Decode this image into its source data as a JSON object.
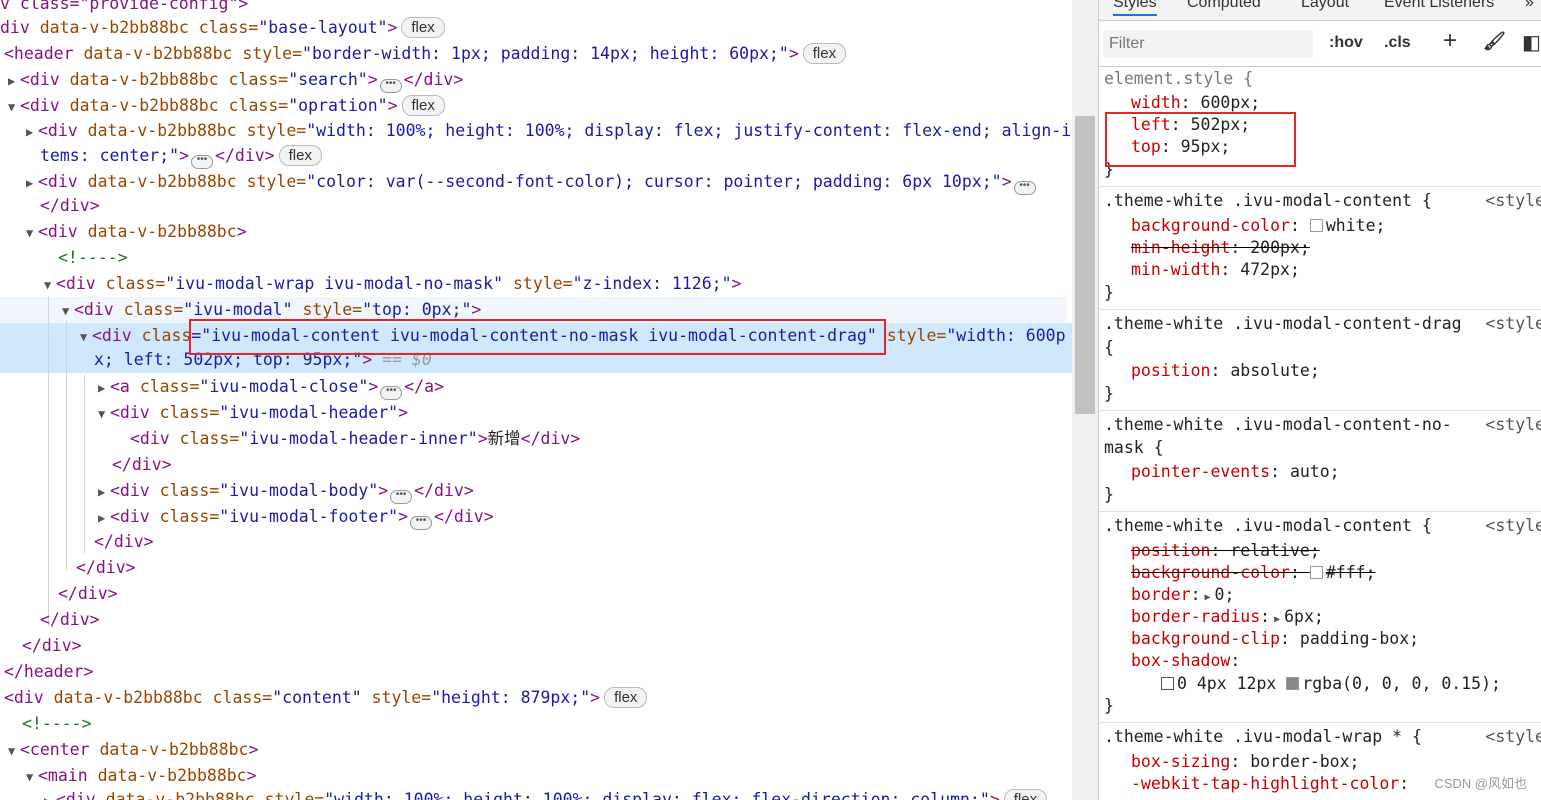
{
  "elements": {
    "l0": "v class=\"provide-config\">",
    "l1_open": "div ",
    "l1_attr": "data-v-b2bb88bc",
    "l1_cls": " class=",
    "l1_val": "\"base-layout\"",
    "l1_close": ">",
    "l1_pill": "flex",
    "l2_open": "<header ",
    "l2_attr": "data-v-b2bb88bc",
    "l2_sty": " style=",
    "l2_val": "\"border-width: 1px; padding: 14px; height: 60px;\"",
    "l2_close": ">",
    "l2_pill": "flex",
    "l3_open": "<div ",
    "l3_attr": "data-v-b2bb88bc",
    "l3_cls": " class=",
    "l3_val": "\"search\"",
    "l3_close": ">",
    "l3_end": "</div>",
    "l4_open": "<div ",
    "l4_attr": "data-v-b2bb88bc",
    "l4_cls": " class=",
    "l4_val": "\"opration\"",
    "l4_close": ">",
    "l4_pill": "flex",
    "l5_open": "<div ",
    "l5_attr": "data-v-b2bb88bc",
    "l5_sty": " style=",
    "l5_val": "\"width: 100%; height: 100%; display: flex; justify-content: flex-end; align-i",
    "l6_val": "tems: center;\"",
    "l6_close": ">",
    "l6_end": "</div>",
    "l6_pill": "flex",
    "l7_open": "<div ",
    "l7_attr": "data-v-b2bb88bc",
    "l7_sty": " style=",
    "l7_val": "\"color: var(--second-font-color); cursor: pointer; padding: 6px 10px;\"",
    "l7_close": ">",
    "l8": "</div>",
    "l9_open": "<div ",
    "l9_attr": "data-v-b2bb88bc",
    "l9_close": ">",
    "l10": "<!---->",
    "l11_open": "<div ",
    "l11_cls": "class=",
    "l11_val": "\"ivu-modal-wrap ivu-modal-no-mask\"",
    "l11_sty": " style=",
    "l11_sval": "\"z-index: 1126;\"",
    "l11_close": ">",
    "l12_open": "<div ",
    "l12_cls": "class=",
    "l12_val": "\"ivu-modal\"",
    "l12_sty": " style=",
    "l12_sval": "\"top: 0px;\"",
    "l12_close": ">",
    "l13_open": "<div ",
    "l13_cls": "class",
    "l13_val": "=\"ivu-modal-content ivu-modal-content-no-mask ivu-modal-content-drag\"",
    "l13_sty": " style=",
    "l13_sval": "\"width: 600p",
    "l14_sval": "x; left: 502px; top: 95px;\"",
    "l14_close": ">",
    "l14_eq": " == $0",
    "l15_open": "<a ",
    "l15_cls": "class=",
    "l15_val": "\"ivu-modal-close\"",
    "l15_close": ">",
    "l15_end": "</a>",
    "l16_open": "<div ",
    "l16_cls": "class=",
    "l16_val": "\"ivu-modal-header\"",
    "l16_close": ">",
    "l17_open": "<div ",
    "l17_cls": "class=",
    "l17_val": "\"ivu-modal-header-inner\"",
    "l17_close": ">",
    "l17_txt": "新增",
    "l17_end": "</div>",
    "l18": "</div>",
    "l19_open": "<div ",
    "l19_cls": "class=",
    "l19_val": "\"ivu-modal-body\"",
    "l19_close": ">",
    "l19_end": "</div>",
    "l20_open": "<div ",
    "l20_cls": "class=",
    "l20_val": "\"ivu-modal-footer\"",
    "l20_close": ">",
    "l20_end": "</div>",
    "l21": "</div>",
    "l22": "</div>",
    "l23": "</div>",
    "l24": "</div>",
    "l25": "</div>",
    "l26": "</header>",
    "l27_open": "<div ",
    "l27_attr": "data-v-b2bb88bc",
    "l27_cls": " class=",
    "l27_val": "\"content\"",
    "l27_sty": " style=",
    "l27_sval": "\"height: 879px;\"",
    "l27_close": ">",
    "l27_pill": "flex",
    "l28": "<!---->",
    "l29_open": "<center ",
    "l29_attr": "data-v-b2bb88bc",
    "l29_close": ">",
    "l30_open": "<main ",
    "l30_attr": "data-v-b2bb88bc",
    "l30_close": ">",
    "l31_open": "<div ",
    "l31_attr": "data-v-b2bb88bc",
    "l31_sty": " style=",
    "l31_val": "\"width: 100%; height: 100%; display: flex; flex-direction: column;\"",
    "l31_close": ">",
    "l31_pill": "flex"
  },
  "tabs": [
    "Styles",
    "Computed",
    "Layout",
    "Event Listeners",
    "»"
  ],
  "filter": {
    "placeholder": "Filter",
    "hov": ":hov",
    "cls": ".cls",
    "plus": "+",
    "paint": "🖌",
    "toggle": "◧"
  },
  "styles": {
    "s0_sel": "element.style {",
    "s1_p": "width",
    "s1_v": ": 600px;",
    "s2_p": "left",
    "s2_v": ": 502px;",
    "s3_p": "top",
    "s3_v": ": 95px;",
    "s4": "}",
    "s5_sel": ".theme-white .ivu-modal-content {",
    "s5_src": "<style",
    "s6_p": "background-color",
    "s6_v": "white;",
    "s7_p": "min-height",
    "s7_v": ": 200px;",
    "s8_p": "min-width",
    "s8_v": ": 472px;",
    "s9": "}",
    "s10_sel": ".theme-white .ivu-modal-content-drag",
    "s10_src": "<style",
    "s11": "{",
    "s12_p": "position",
    "s12_v": ": absolute;",
    "s13": "}",
    "s14_sel": ".theme-white .ivu-modal-content-no-",
    "s14_src": "<style",
    "s15": "mask {",
    "s16_p": "pointer-events",
    "s16_v": ": auto;",
    "s17": "}",
    "s18_sel": ".theme-white .ivu-modal-content {",
    "s18_src": "<style",
    "s19_p": "position",
    "s19_v": ": relative;",
    "s20_p": "background-color",
    "s20_v": "#fff;",
    "s21_p": "border",
    "s21_v": "0;",
    "s22_p": "border-radius",
    "s22_v": "6px;",
    "s23_p": "background-clip",
    "s23_v": ": padding-box;",
    "s24_p": "box-shadow",
    "s24_v": ":",
    "s25_v": "0 4px 12px",
    "s25_v2": "rgba(0, 0, 0, 0.15);",
    "s26": "}",
    "s27_sel": ".theme-white .ivu-modal-wrap * {",
    "s27_src": "<style",
    "s28_p": "box-sizing",
    "s28_v": ": border-box;",
    "s29_p": "-webkit-tap-highlight-color",
    "s29_v": ":"
  },
  "watermark": "CSDN @风如也",
  "colors": {
    "highlight_red": "#e5252a",
    "selected_bg": "#cfe8fc",
    "tag": "#881280",
    "attr": "#994500",
    "value": "#1a1aa6"
  }
}
